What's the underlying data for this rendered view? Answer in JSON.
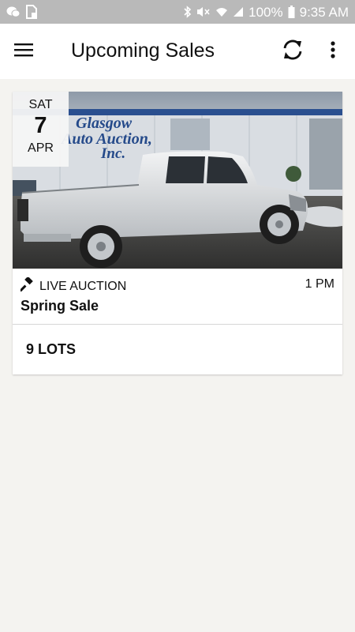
{
  "status_bar": {
    "battery": "100%",
    "time": "9:35 AM"
  },
  "app_bar": {
    "title": "Upcoming Sales",
    "icons": [
      "menu-icon",
      "refresh-icon",
      "more-vert-icon"
    ]
  },
  "sale": {
    "date": {
      "dow": "SAT",
      "day": "7",
      "month": "APR"
    },
    "image_sign_text": "Glasgow Auto Auction, Inc.",
    "type_icon": "gavel-icon",
    "type": "LIVE AUCTION",
    "time": "1 PM",
    "name": "Spring Sale",
    "lots": "9 LOTS"
  }
}
